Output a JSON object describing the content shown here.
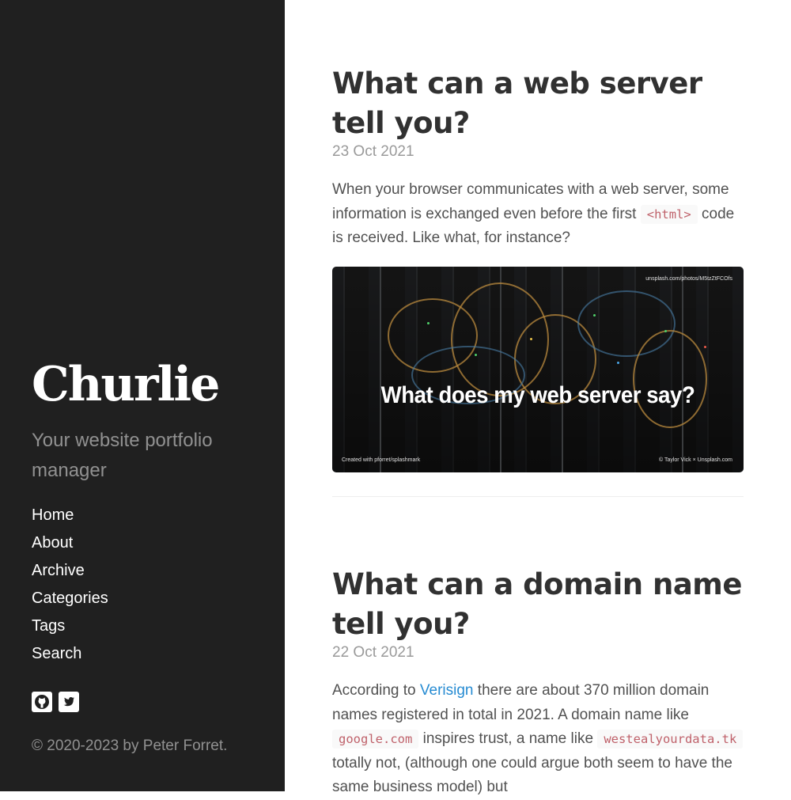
{
  "sidebar": {
    "title": "Churlie",
    "tagline": "Your website portfolio manager",
    "nav": [
      "Home",
      "About",
      "Archive",
      "Categories",
      "Tags",
      "Search"
    ],
    "social_icons": [
      "github-icon",
      "twitter-icon"
    ],
    "copyright": "© 2020-2023 by Peter Forret."
  },
  "posts": [
    {
      "title": "What can a web server tell you?",
      "date": "23 Oct 2021",
      "excerpt_part1": "When your browser communicates with a web server, some information is exchanged even before the first ",
      "excerpt_code": "<html>",
      "excerpt_part2": " code is received. Like what, for instance?",
      "image": {
        "caption": "What does my web server say?",
        "url_text": "unsplash.com/photos/M5tzZtFCOfs",
        "credit_left": "Created with pforret/splashmark",
        "credit_right": "© Taylor Vick × Unsplash.com"
      }
    },
    {
      "title": "What can a domain name tell you?",
      "date": "22 Oct 2021",
      "excerpt_part1": "According to ",
      "excerpt_link": "Verisign",
      "excerpt_part2": " there are about 370 million domain names registered in total in 2021. A domain name like ",
      "excerpt_code1": "google.com",
      "excerpt_part3": " inspires trust, a name like ",
      "excerpt_code2": "westealyourdata.tk",
      "excerpt_part4": " totally not, (although one could argue both seem to have the same business model) but"
    }
  ],
  "colors": {
    "sidebar_bg": "#202020",
    "link": "#268bd2",
    "code": "#bf616a"
  }
}
